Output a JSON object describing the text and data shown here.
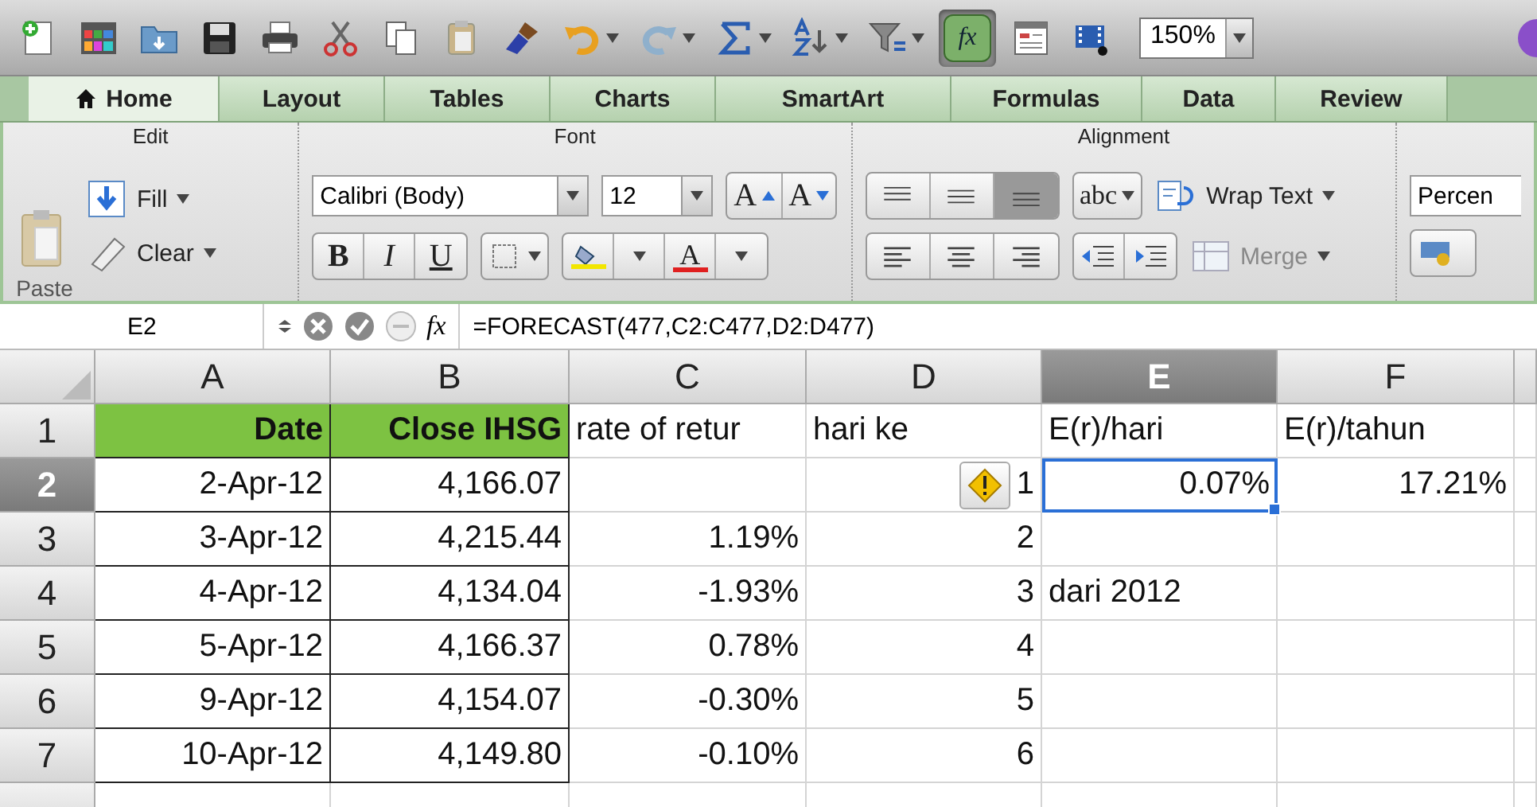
{
  "toolbar": {
    "buttons": [
      {
        "kind": "new"
      },
      {
        "kind": "gallery"
      },
      {
        "kind": "open"
      },
      {
        "kind": "save"
      },
      {
        "kind": "print"
      },
      {
        "kind": "cut"
      },
      {
        "kind": "copy"
      },
      {
        "kind": "paste"
      },
      {
        "kind": "brush"
      },
      {
        "kind": "undo",
        "menu": true
      },
      {
        "kind": "redo",
        "menu": true
      },
      {
        "kind": "sum",
        "menu": true
      },
      {
        "kind": "sort",
        "menu": true
      },
      {
        "kind": "filter",
        "menu": true
      },
      {
        "kind": "fx",
        "selected": true,
        "label": "fx"
      },
      {
        "kind": "toolbox"
      },
      {
        "kind": "media"
      }
    ],
    "zoom": "150%"
  },
  "tabs": [
    {
      "label": "Home",
      "selected": true
    },
    {
      "label": "Layout",
      "selected": false
    },
    {
      "label": "Tables",
      "selected": false
    },
    {
      "label": "Charts",
      "selected": false
    },
    {
      "label": "SmartArt",
      "selected": false
    },
    {
      "label": "Formulas",
      "selected": false
    },
    {
      "label": "Data",
      "selected": false
    },
    {
      "label": "Review",
      "selected": false
    }
  ],
  "ribbon": {
    "edit": {
      "title": "Edit",
      "paste": "Paste",
      "fill": "Fill",
      "clear": "Clear"
    },
    "font": {
      "title": "Font",
      "family": "Calibri (Body)",
      "size": "12",
      "grow": "A",
      "shrink": "A",
      "bold": "B",
      "italic": "I",
      "underline": "U",
      "font_color": "A"
    },
    "alignment": {
      "title": "Alignment",
      "vertical": [
        {
          "selected": false
        },
        {
          "selected": false
        },
        {
          "selected": true
        }
      ],
      "orientation": "abc",
      "wrap": "Wrap Text",
      "merge": {
        "label": "Merge",
        "disabled": true
      }
    },
    "number": {
      "format": "Percen"
    }
  },
  "formula_bar": {
    "cell": "E2",
    "fx": "fx",
    "formula": "=FORECAST(477,C2:C477,D2:D477)"
  },
  "sheet": {
    "columns": [
      {
        "label": "A",
        "selected": false
      },
      {
        "label": "B",
        "selected": false
      },
      {
        "label": "C",
        "selected": false
      },
      {
        "label": "D",
        "selected": false
      },
      {
        "label": "E",
        "selected": true
      },
      {
        "label": "F",
        "selected": false
      }
    ],
    "rows": [
      {
        "label": "1",
        "selected": false,
        "cells": [
          {
            "text": "Date",
            "kind": "heading"
          },
          {
            "text": "Close IHSG",
            "kind": "heading"
          },
          {
            "text": "rate of retur",
            "kind": "label"
          },
          {
            "text": "hari ke",
            "kind": "label"
          },
          {
            "text": "E(r)/hari",
            "kind": "label"
          },
          {
            "text": "E(r)/tahun",
            "kind": "label"
          }
        ]
      },
      {
        "label": "2",
        "selected": true,
        "cells": [
          {
            "text": "2-Apr-12",
            "kind": "value"
          },
          {
            "text": "4,166.07",
            "kind": "value"
          },
          null,
          {
            "text": "1",
            "kind": "value",
            "warning": true
          },
          {
            "text": "0.07%",
            "kind": "value"
          },
          {
            "text": "17.21%",
            "kind": "value"
          }
        ]
      },
      {
        "label": "3",
        "selected": false,
        "cells": [
          {
            "text": "3-Apr-12",
            "kind": "value"
          },
          {
            "text": "4,215.44",
            "kind": "value"
          },
          {
            "text": "1.19%",
            "kind": "value"
          },
          {
            "text": "2",
            "kind": "value"
          },
          null,
          null
        ]
      },
      {
        "label": "4",
        "selected": false,
        "cells": [
          {
            "text": "4-Apr-12",
            "kind": "value"
          },
          {
            "text": "4,134.04",
            "kind": "value"
          },
          {
            "text": "-1.93%",
            "kind": "value"
          },
          {
            "text": "3",
            "kind": "value"
          },
          {
            "text": "dari 2012",
            "kind": "label"
          },
          null
        ]
      },
      {
        "label": "5",
        "selected": false,
        "cells": [
          {
            "text": "5-Apr-12",
            "kind": "value"
          },
          {
            "text": "4,166.37",
            "kind": "value"
          },
          {
            "text": "0.78%",
            "kind": "value"
          },
          {
            "text": "4",
            "kind": "value"
          },
          null,
          null
        ]
      },
      {
        "label": "6",
        "selected": false,
        "cells": [
          {
            "text": "9-Apr-12",
            "kind": "value"
          },
          {
            "text": "4,154.07",
            "kind": "value"
          },
          {
            "text": "-0.30%",
            "kind": "value"
          },
          {
            "text": "5",
            "kind": "value"
          },
          null,
          null
        ]
      },
      {
        "label": "7",
        "selected": false,
        "cells": [
          {
            "text": "10-Apr-12",
            "kind": "value"
          },
          {
            "text": "4,149.80",
            "kind": "value"
          },
          {
            "text": "-0.10%",
            "kind": "value"
          },
          {
            "text": "6",
            "kind": "value"
          },
          null,
          null
        ]
      }
    ]
  }
}
